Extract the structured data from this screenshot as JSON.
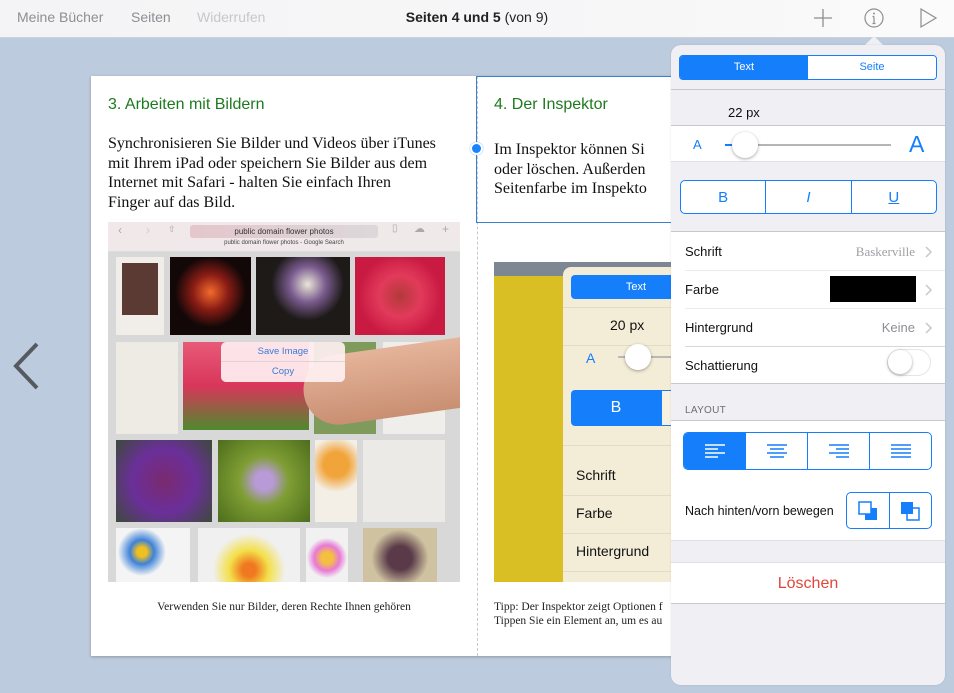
{
  "toolbar": {
    "my_books": "Meine Bücher",
    "pages": "Seiten",
    "undo": "Widerrufen",
    "title_bold": "Seiten 4 und 5",
    "title_rest": " (von 9)",
    "icons": [
      "plus-icon",
      "info-icon",
      "play-icon"
    ]
  },
  "book": {
    "left_page": {
      "heading": "3. Arbeiten mit Bildern",
      "body_lines": [
        "Synchronisieren Sie Bilder und Videos über iTunes",
        "mit Ihrem iPad oder speichern Sie Bilder aus dem",
        "Internet mit Safari - halten Sie einfach Ihren",
        "Finger auf das Bild."
      ],
      "image": {
        "url_text": "public domain flower photos",
        "tab_title": "public domain flower photos - Google Search",
        "context_menu": [
          "Save Image",
          "Copy"
        ]
      },
      "caption": "Verwenden Sie nur Bilder, deren Rechte Ihnen gehören"
    },
    "right_page": {
      "heading": "4. Der Inspektor",
      "body_lines": [
        "Im Inspektor können Si",
        "oder löschen. Außerden",
        "Seitenfarbe im Inspekto"
      ],
      "image": {
        "segment": "Text",
        "size": "20 px",
        "slider_a": "A",
        "bold": "B",
        "rows": [
          "Schrift",
          "Farbe",
          "Hintergrund"
        ]
      },
      "caption_lines": [
        "Tipp: Der Inspektor zeigt Optionen f",
        "Tippen Sie ein Element an, um es au"
      ]
    }
  },
  "inspector": {
    "tabs": [
      {
        "label": "Text",
        "active": true
      },
      {
        "label": "Seite",
        "active": false
      }
    ],
    "font_size": "22 px",
    "font_size_fraction": 0.1,
    "small_a": "A",
    "large_a": "A",
    "style_buttons": [
      "B",
      "I",
      "U"
    ],
    "rows": {
      "font": {
        "label": "Schrift",
        "value": "Baskerville"
      },
      "color": {
        "label": "Farbe",
        "value": "#000000"
      },
      "background": {
        "label": "Hintergrund",
        "value": "Keine"
      },
      "shadow": {
        "label": "Schattierung",
        "on": false
      }
    },
    "layout_header": "LAYOUT",
    "alignment": {
      "options": [
        "align-left",
        "align-center",
        "align-right",
        "justify"
      ],
      "selected": "align-left"
    },
    "arrange_label": "Nach hinten/vorn bewegen",
    "arrange_buttons": [
      "send-backward",
      "bring-forward"
    ],
    "delete_label": "Löschen"
  },
  "colors": {
    "accent": "#157efb",
    "heading_green": "#1e7a1e",
    "delete_red": "#e0463b",
    "background": "#bccbdd"
  }
}
